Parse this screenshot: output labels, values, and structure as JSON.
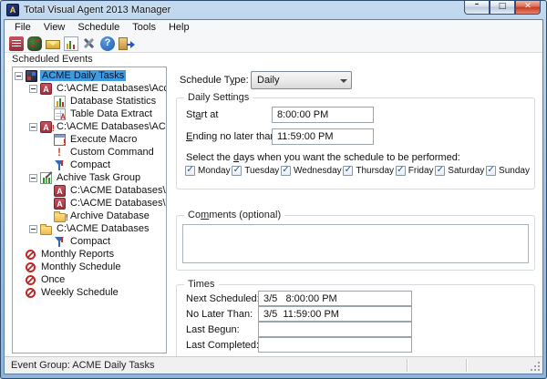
{
  "window": {
    "title": "Total Visual Agent 2013 Manager"
  },
  "menu": {
    "items": [
      "File",
      "View",
      "Schedule",
      "Tools",
      "Help"
    ]
  },
  "toolbar": {
    "icons": [
      "access-report-icon",
      "event-groups-icon",
      "mail-icon",
      "statistics-icon",
      "tools-icon",
      "help-icon",
      "exit-icon"
    ]
  },
  "sidebar": {
    "heading": "Scheduled Events",
    "tree": [
      {
        "depth": 0,
        "expander": "-",
        "icon": "task-group-icon",
        "label": "ACME Daily Tasks",
        "selected": true
      },
      {
        "depth": 1,
        "expander": "-",
        "icon": "access-database-icon",
        "label": "C:\\ACME Databases\\Account"
      },
      {
        "depth": 2,
        "icon": "statistics-icon",
        "label": "Database Statistics"
      },
      {
        "depth": 2,
        "icon": "table-extract-icon",
        "label": "Table Data Extract"
      },
      {
        "depth": 1,
        "expander": "-",
        "icon": "access-database-alert-icon",
        "label": "C:\\ACME Databases\\ACME Wa"
      },
      {
        "depth": 2,
        "icon": "execute-macro-icon",
        "label": "Execute Macro"
      },
      {
        "depth": 2,
        "icon": "exclamation-icon",
        "label": "Custom Command"
      },
      {
        "depth": 2,
        "icon": "compact-icon",
        "label": "Compact"
      },
      {
        "depth": 1,
        "expander": "-",
        "icon": "archive-task-group-icon",
        "label": "Achive Task Group"
      },
      {
        "depth": 2,
        "icon": "access-database-icon",
        "label": "C:\\ACME Databases\\Acco"
      },
      {
        "depth": 2,
        "icon": "access-database-icon",
        "label": "C:\\ACME Databases\\Time"
      },
      {
        "depth": 2,
        "icon": "archive-folder-icon",
        "label": "Archive Database"
      },
      {
        "depth": 1,
        "expander": "-",
        "icon": "folder-icon",
        "label": "C:\\ACME Databases"
      },
      {
        "depth": 2,
        "icon": "compact-icon",
        "label": "Compact"
      },
      {
        "depth": 0,
        "icon": "disabled-icon",
        "label": "Monthly Reports"
      },
      {
        "depth": 0,
        "icon": "disabled-icon",
        "label": "Monthly Schedule"
      },
      {
        "depth": 0,
        "icon": "disabled-icon",
        "label": "Once"
      },
      {
        "depth": 0,
        "icon": "disabled-icon",
        "label": "Weekly Schedule"
      }
    ]
  },
  "schedule_type": {
    "label": {
      "pre": "Schedule T",
      "mn": "y",
      "post": "pe:"
    },
    "value": "Daily"
  },
  "daily_settings": {
    "legend": "Daily Settings",
    "start_label": {
      "pre": "St",
      "mn": "a",
      "post": "rt at"
    },
    "start_value": "8:00:00 PM",
    "ending_label": {
      "pre": "",
      "mn": "E",
      "post": "nding no later than"
    },
    "ending_value": "11:59:00 PM",
    "days_label": {
      "pre": "Select the ",
      "mn": "d",
      "post": "ays when you want the schedule to be performed:"
    },
    "days": [
      "Monday",
      "Tuesday",
      "Wednesday",
      "Thursday",
      "Friday",
      "Saturday",
      "Sunday"
    ],
    "days_checked": [
      true,
      true,
      true,
      true,
      true,
      true,
      true
    ]
  },
  "comments": {
    "legend": {
      "pre": "Co",
      "mn": "m",
      "post": "ments (optional)"
    },
    "value": ""
  },
  "times": {
    "legend": "Times",
    "rows": [
      {
        "label": "Next Scheduled:",
        "value": "3/5   8:00:00 PM"
      },
      {
        "label": "No Later Than:",
        "value": "3/5  11:59:00 PM"
      },
      {
        "label": "Last Begun:",
        "value": ""
      },
      {
        "label": "Last Completed:",
        "value": ""
      }
    ]
  },
  "statusbar": {
    "text": "Event Group: ACME Daily Tasks"
  },
  "colors": {
    "titlebar_blue": "#a9c6e2",
    "selection_blue": "#3f9be0",
    "close_button_red": "#c53b2b",
    "access_red": "#a33540",
    "folder_yellow": "#eebb4d",
    "disabled_red": "#cc2222",
    "help_blue": "#2a72c8"
  }
}
